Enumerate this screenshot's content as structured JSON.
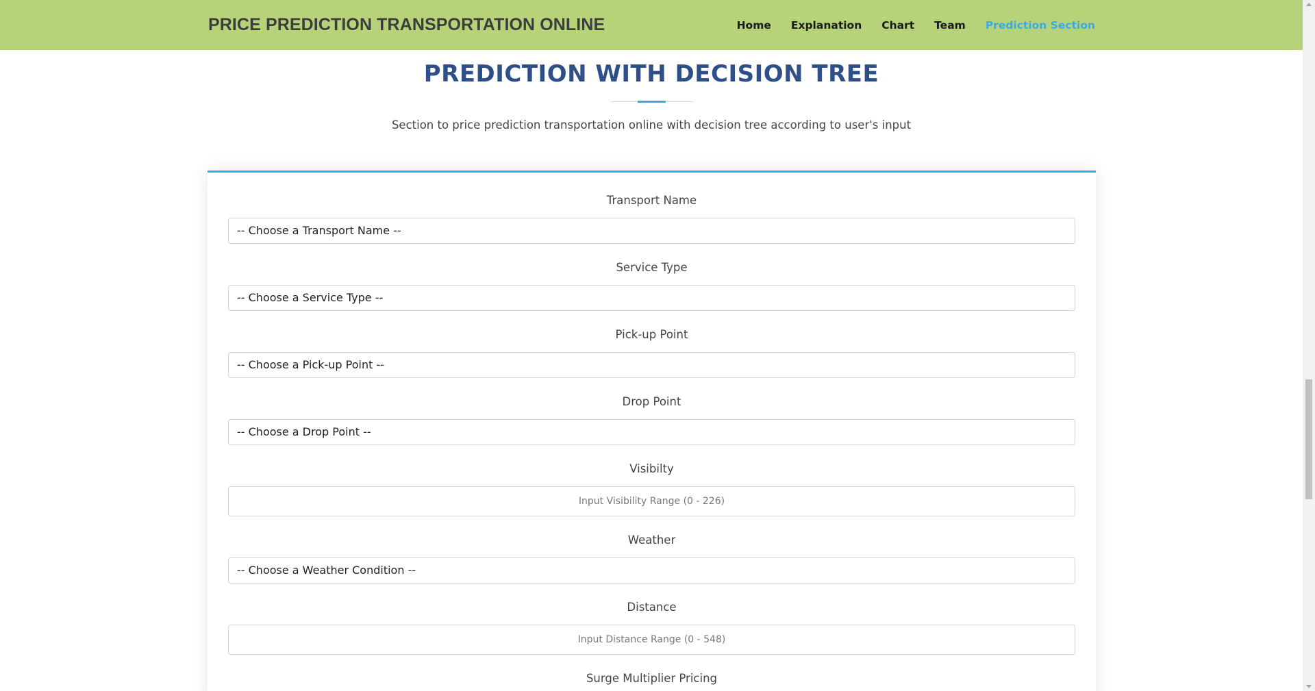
{
  "navbar": {
    "brand": "PRICE PREDICTION TRANSPORTATION ONLINE",
    "links": [
      {
        "label": "Home",
        "active": false
      },
      {
        "label": "Explanation",
        "active": false
      },
      {
        "label": "Chart",
        "active": false
      },
      {
        "label": "Team",
        "active": false
      },
      {
        "label": "Prediction Section",
        "active": true
      }
    ]
  },
  "section": {
    "title": "PREDICTION WITH DECISION TREE",
    "subtitle": "Section to price prediction transportation online with decision tree according to user's input"
  },
  "form": {
    "transport_name": {
      "label": "Transport Name",
      "value": "-- Choose a Transport Name --"
    },
    "service_type": {
      "label": "Service Type",
      "value": "-- Choose a Service Type --"
    },
    "pickup_point": {
      "label": "Pick-up Point",
      "value": "-- Choose a Pick-up Point --"
    },
    "drop_point": {
      "label": "Drop Point",
      "value": "-- Choose a Drop Point --"
    },
    "visibility": {
      "label": "Visibilty",
      "placeholder": "Input Visibility Range (0 - 226)"
    },
    "weather": {
      "label": "Weather",
      "value": "-- Choose a Weather Condition --"
    },
    "distance": {
      "label": "Distance",
      "placeholder": "Input Distance Range (0 - 548)"
    },
    "surge_multiplier": {
      "label": "Surge Multiplier Pricing"
    }
  },
  "colors": {
    "navbar_bg": "#b6d37a",
    "accent": "#3aa9e8",
    "title": "#2f4f88"
  }
}
